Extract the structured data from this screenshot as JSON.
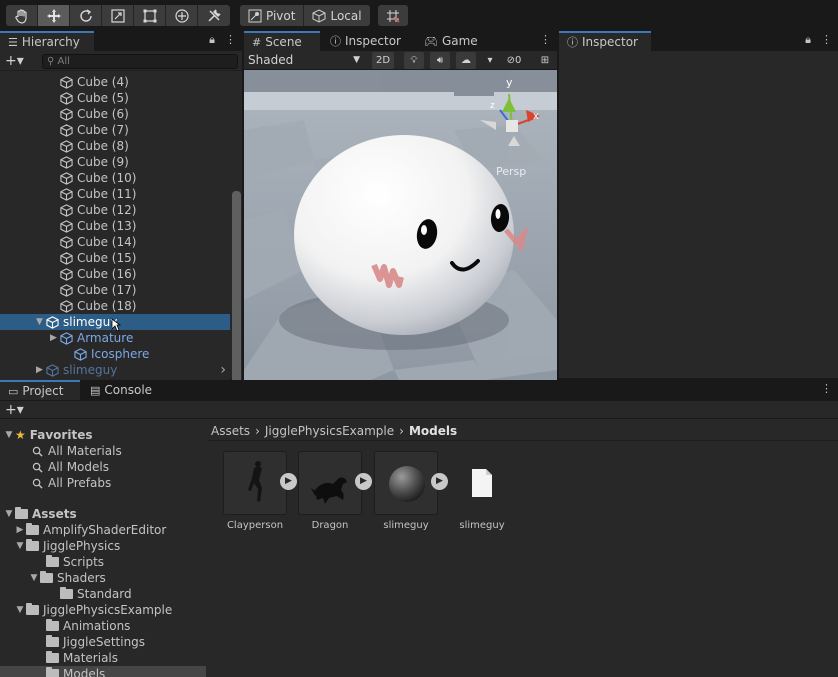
{
  "toolbar": {
    "tools": [
      "hand-tool",
      "move-tool",
      "rotate-tool",
      "scale-tool",
      "rect-tool",
      "transform-tool",
      "custom-tool"
    ],
    "pivot_label": "Pivot",
    "local_label": "Local"
  },
  "hierarchy": {
    "tab_label": "Hierarchy",
    "search_placeholder": "All",
    "items": [
      {
        "label": "Cube (4)"
      },
      {
        "label": "Cube (5)"
      },
      {
        "label": "Cube (6)"
      },
      {
        "label": "Cube (7)"
      },
      {
        "label": "Cube (8)"
      },
      {
        "label": "Cube (9)"
      },
      {
        "label": "Cube (10)"
      },
      {
        "label": "Cube (11)"
      },
      {
        "label": "Cube (12)"
      },
      {
        "label": "Cube (13)"
      },
      {
        "label": "Cube (14)"
      },
      {
        "label": "Cube (15)"
      },
      {
        "label": "Cube (16)"
      },
      {
        "label": "Cube (17)"
      },
      {
        "label": "Cube (18)"
      },
      {
        "label": "slimeguy"
      },
      {
        "label": "Armature"
      },
      {
        "label": "Icosphere"
      },
      {
        "label": "slimeguy"
      }
    ]
  },
  "scene": {
    "tabs": [
      "Scene",
      "Inspector",
      "Game"
    ],
    "shading_mode": "Shaded",
    "mode_2d": "2D",
    "hidden_count": "0",
    "persp_label": "Persp",
    "gizmo_axes": {
      "y": "y",
      "x": "x",
      "z": "z"
    }
  },
  "inspector": {
    "tab_label": "Inspector"
  },
  "project": {
    "tabs": [
      "Project",
      "Console"
    ],
    "favorites": {
      "label": "Favorites",
      "items": [
        "All Materials",
        "All Models",
        "All Prefabs"
      ]
    },
    "assets_label": "Assets",
    "tree": [
      {
        "label": "AmplifyShaderEditor"
      },
      {
        "label": "JigglePhysics"
      },
      {
        "label": "Scripts"
      },
      {
        "label": "Shaders"
      },
      {
        "label": "Standard"
      },
      {
        "label": "JigglePhysicsExample"
      },
      {
        "label": "Animations"
      },
      {
        "label": "JiggleSettings"
      },
      {
        "label": "Materials"
      },
      {
        "label": "Models"
      }
    ],
    "breadcrumb": [
      "Assets",
      "JigglePhysicsExample",
      "Models"
    ],
    "assets": [
      {
        "label": "Clayperson"
      },
      {
        "label": "Dragon"
      },
      {
        "label": "slimeguy"
      },
      {
        "label": "slimeguy"
      }
    ]
  }
}
